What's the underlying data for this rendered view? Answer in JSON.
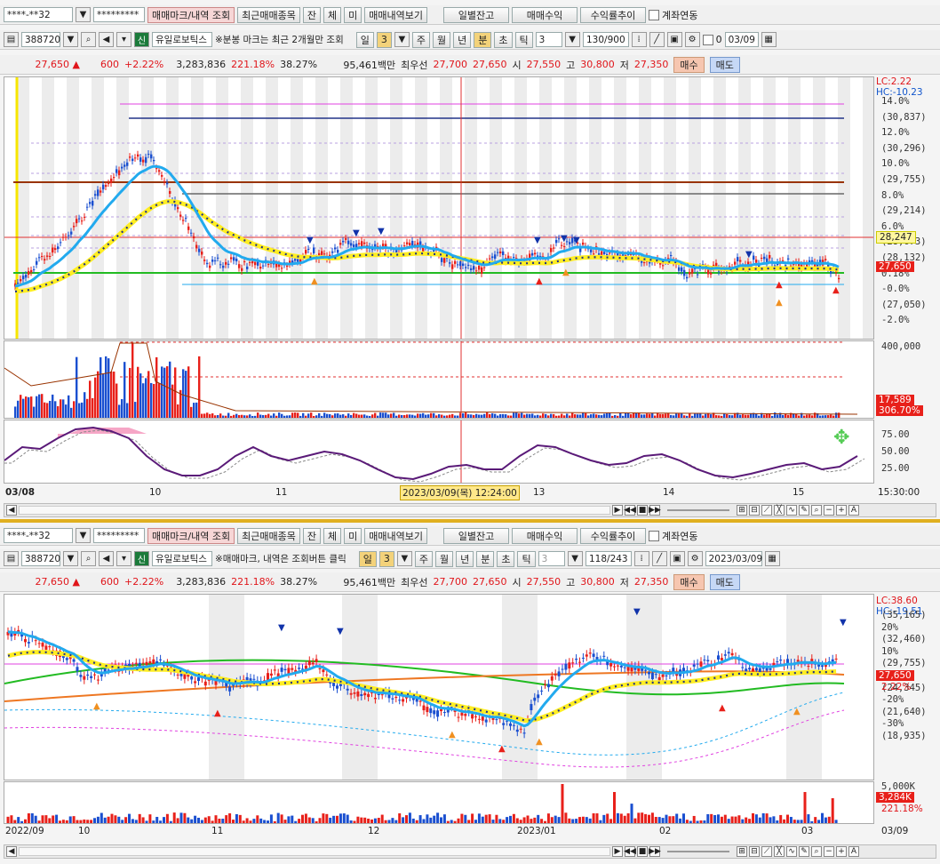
{
  "top": {
    "account": "****-**32",
    "password": "*********",
    "tabs": [
      "매매마크/내역 조회",
      "최근매매종목",
      "잔",
      "체",
      "미",
      "매매내역보기"
    ],
    "buttons": [
      "일별잔고",
      "매매수익",
      "수익률추이"
    ],
    "link_label": "계좌연동",
    "code": "388720",
    "stock_name": "유일로보틱스",
    "badge": "신",
    "notice": "※분봉 마크는 최근 2개월만 조회",
    "periods": [
      "일",
      "3",
      "주",
      "월",
      "년",
      "분",
      "초",
      "틱",
      "3"
    ],
    "count": "130/900",
    "zero": "0",
    "date": "03/09",
    "quote": {
      "price": "27,650 ▲",
      "change": "600",
      "rate": "+2.22%",
      "volume": "3,283,836",
      "vr": "221.18%",
      "turnover": "38.27%",
      "amount": "95,461백만",
      "best_label": "최우선",
      "ask": "27,700",
      "bid": "27,650",
      "open_label": "시",
      "open": "27,550",
      "high_label": "고",
      "high": "30,800",
      "low_label": "저",
      "low": "27,350",
      "buy": "매수",
      "sell": "매도"
    },
    "right_axis": [
      "14.0%",
      "(30,837)",
      "12.0%",
      "(30,296)",
      "10.0%",
      "(29,755)",
      "8.0%",
      "(29,214)",
      "6.0%",
      "(28,673)",
      "(28,132)",
      "0.18%",
      "-0.0%",
      "(27,050)",
      "-2.0%"
    ],
    "lc": "LC:2.22",
    "hc": "HC:-10.23",
    "price_tags": {
      "cross": "28,247",
      "last": "27,650"
    },
    "vol_axis": {
      "max": "400,000",
      "v": "17,589",
      "r": "306.70%"
    },
    "osc_axis": [
      "75.00",
      "50.00",
      "25.00"
    ],
    "time_axis": [
      "03/08",
      "10",
      "11",
      "13",
      "14",
      "15",
      "15:30:00"
    ],
    "cursor_label": "2023/03/09(목) 12:24:00"
  },
  "bottom": {
    "account": "****-**32",
    "password": "*********",
    "tabs": [
      "매매마크/내역 조회",
      "최근매매종목",
      "잔",
      "체",
      "미",
      "매매내역보기"
    ],
    "buttons": [
      "일별잔고",
      "매매수익",
      "수익률추이"
    ],
    "link_label": "계좌연동",
    "code": "388720",
    "stock_name": "유일로보틱스",
    "badge": "신",
    "notice": "※매매마크, 내역은 조회버튼 클릭",
    "periods": [
      "일",
      "3",
      "주",
      "월",
      "년",
      "분",
      "초",
      "틱",
      "3"
    ],
    "count": "118/243",
    "date": "2023/03/09",
    "quote": {
      "price": "27,650 ▲",
      "change": "600",
      "rate": "+2.22%",
      "volume": "3,283,836",
      "vr": "221.18%",
      "turnover": "38.27%",
      "amount": "95,461백만",
      "best_label": "최우선",
      "ask": "27,700",
      "bid": "27,650",
      "open_label": "시",
      "open": "27,550",
      "high_label": "고",
      "high": "30,800",
      "low_label": "저",
      "low": "27,350",
      "buy": "매수",
      "sell": "매도"
    },
    "right_axis": [
      "(35,165)",
      "20%",
      "(32,460)",
      "10%",
      "(29,755)",
      "-10%",
      "(24,345)",
      "-20%",
      "(21,640)",
      "-30%",
      "(18,935)"
    ],
    "lc": "LC:38.60",
    "hc": "HC:-19.51",
    "price_tags": {
      "last": "27,650",
      "pct": "2.22%"
    },
    "vol_axis": {
      "max": "5,000K",
      "v": "3,284K",
      "r": "221.18%"
    },
    "time_axis": [
      "2022/09",
      "10",
      "11",
      "12",
      "2023/01",
      "02",
      "03",
      "03/09"
    ]
  },
  "colors": {
    "up": "#e8201a",
    "down": "#1a4fd0",
    "ma_yellow": "#ffee22",
    "ma_cyan": "#22aaee",
    "ma_green": "#22bb22",
    "ma_orange": "#ee7722",
    "accent": "#e0b020"
  }
}
